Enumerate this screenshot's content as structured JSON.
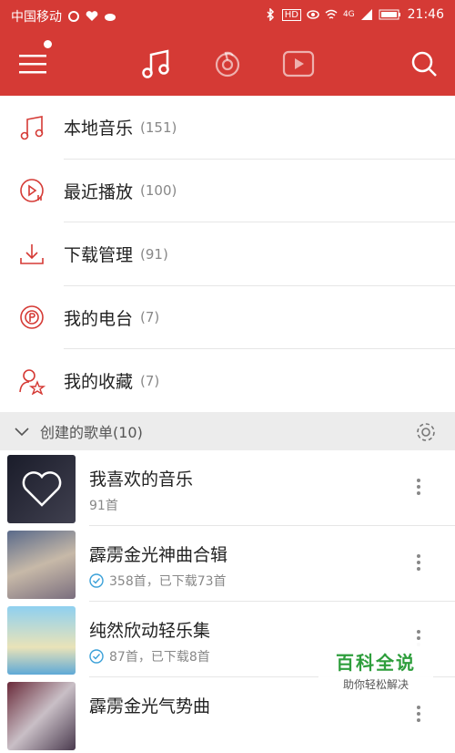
{
  "status_bar": {
    "carrier": "中国移动",
    "network": "4G",
    "time": "21:46",
    "hd_label": "HD"
  },
  "colors": {
    "brand": "#d53a35",
    "accent_check": "#3aa0d8"
  },
  "top_nav": {
    "icons": [
      "menu-icon",
      "music-note-icon",
      "netease-logo-icon",
      "video-play-icon",
      "search-icon"
    ]
  },
  "library_items": [
    {
      "label": "本地音乐",
      "count": "(151)",
      "icon": "music-note-icon"
    },
    {
      "label": "最近播放",
      "count": "(100)",
      "icon": "recent-play-icon"
    },
    {
      "label": "下载管理",
      "count": "(91)",
      "icon": "download-icon"
    },
    {
      "label": "我的电台",
      "count": "(7)",
      "icon": "radio-icon"
    },
    {
      "label": "我的收藏",
      "count": "(7)",
      "icon": "favorites-icon"
    }
  ],
  "section": {
    "label": "创建的歌单(10)"
  },
  "playlists": [
    {
      "title": "我喜欢的音乐",
      "subtitle": "91首",
      "downloaded": false
    },
    {
      "title": "霹雳金光神曲合辑",
      "subtitle": "358首，已下载73首",
      "downloaded": true
    },
    {
      "title": "纯然欣动轻乐集",
      "subtitle": "87首，已下载8首",
      "downloaded": true
    },
    {
      "title": "霹雳金光气势曲",
      "subtitle": "",
      "downloaded": false
    }
  ],
  "watermark": {
    "title": "百科全说",
    "subtitle": "助你轻松解决"
  }
}
